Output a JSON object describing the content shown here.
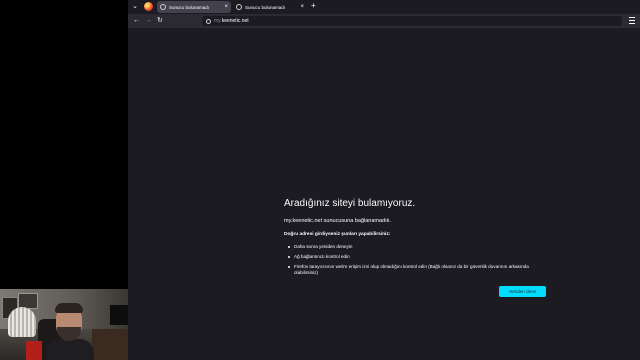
{
  "browser": {
    "tabs": [
      {
        "label": "Sunucu bulunamadı",
        "active": true
      },
      {
        "label": "Sunucu bulunamadı",
        "active": false
      }
    ],
    "newtab_label": "+",
    "url": {
      "subdomain": "my.",
      "domain": "keenetic.net"
    },
    "nav": {
      "back": "←",
      "forward": "→",
      "reload": "↻"
    }
  },
  "error_page": {
    "title": "Aradığınız siteyi bulamıyoruz.",
    "description": "my.keenetic.net sunucusuna bağlanamadık.",
    "subtitle": "Doğru adresi girdiyseniz şunları yapabilirsiniz:",
    "suggestions": [
      "Daha sonra yeniden deneyin",
      "Ağ bağlantınızı kontrol edin",
      "Firefox tarayıcısının web'e erişim izni olup olmadığını kontrol edin (Bağlı olsanız da bir güvenlik duvarının arkasında olabilirsiniz)"
    ],
    "retry_label": "Yeniden dene"
  },
  "colors": {
    "page_bg": "#1c1b22",
    "toolbar_bg": "#2b2a33",
    "active_tab": "#42414d",
    "accent": "#00ddff"
  }
}
